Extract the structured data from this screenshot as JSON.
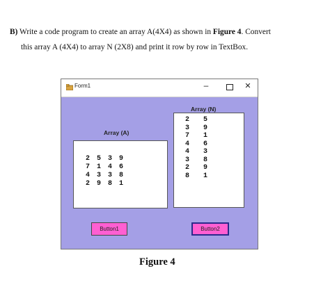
{
  "question": {
    "prefix": "B)",
    "line1_text": " Write a code program to create an array A(4X4) as shown in ",
    "figure_ref": "Figure 4",
    "line1_end": ". Convert",
    "line2": "this array A (4X4) to array N (2X8) and print it row by row in TextBox."
  },
  "form": {
    "title": "Form1",
    "controls": {
      "minimize": "–",
      "close": "✕"
    },
    "label_a": "Array (A)",
    "label_n": "Array (N)",
    "array_a": [
      [
        "2",
        "5",
        "3",
        "9"
      ],
      [
        "7",
        "1",
        "4",
        "6"
      ],
      [
        "4",
        "3",
        "3",
        "8"
      ],
      [
        "2",
        "9",
        "8",
        "1"
      ]
    ],
    "array_n": [
      [
        "2",
        "5"
      ],
      [
        "3",
        "9"
      ],
      [
        "7",
        "1"
      ],
      [
        "4",
        "6"
      ],
      [
        "4",
        "3"
      ],
      [
        "3",
        "8"
      ],
      [
        "2",
        "9"
      ],
      [
        "8",
        "1"
      ]
    ],
    "button1": "Button1",
    "button2": "Button2"
  },
  "caption": "Figure 4",
  "colors": {
    "form_bg": "#a49fe6",
    "button_bg": "#ff5fd2"
  }
}
